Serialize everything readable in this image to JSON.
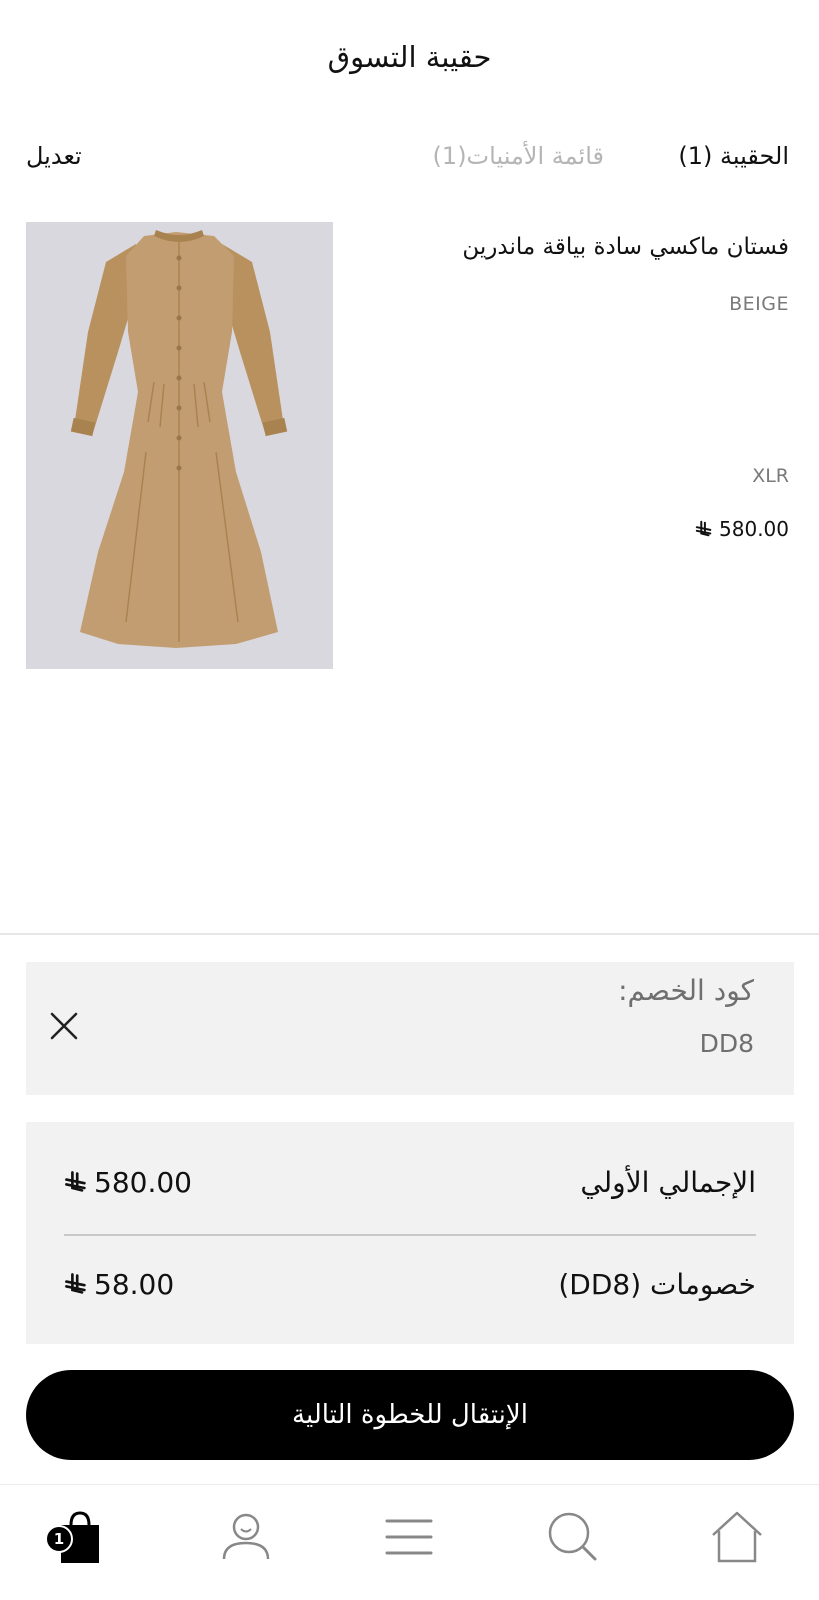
{
  "header": {
    "title": "حقيبة التسوق"
  },
  "tabs": {
    "bag_label": "الحقيبة (1)",
    "wishlist_label": "قائمة الأمنيات(1)",
    "edit_label": "تعديل"
  },
  "product": {
    "name": "فستان ماكسي سادة بياقة ماندرين",
    "color": "BEIGE",
    "size": "XLR",
    "price": "580.00",
    "currency_icon": "saudi-riyal-icon"
  },
  "discount": {
    "label": "كود الخصم:",
    "code": "DD8",
    "remove_icon": "close-icon"
  },
  "totals": {
    "subtotal_label": "الإجمالي الأولي",
    "subtotal_value": "580.00",
    "discount_label": "خصومات (DD8)",
    "discount_value": "58.00"
  },
  "checkout": {
    "label": "الإنتقال للخطوة التالية"
  },
  "bottom_nav": {
    "bag_badge": "1",
    "items": [
      "bag-icon",
      "account-icon",
      "menu-icon",
      "search-icon",
      "home-icon"
    ]
  },
  "colors": {
    "accent": "#000000",
    "panel_bg": "#f2f2f2",
    "muted_text": "#7a7a7a",
    "inactive_tab": "#b5b5b5",
    "dress": "#c39d72",
    "image_bg": "#d9d8de"
  }
}
